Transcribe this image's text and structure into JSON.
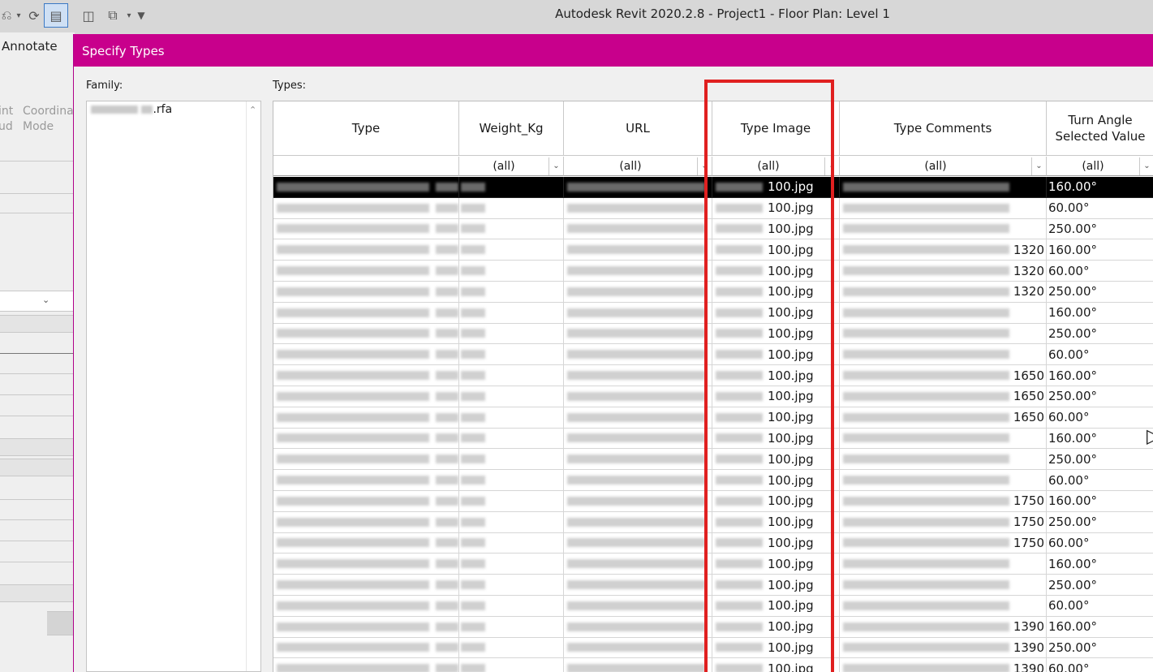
{
  "app": {
    "title": "Autodesk Revit 2020.2.8 - Project1 - Floor Plan: Level 1",
    "ribbon_tab": "Annotate",
    "ribbon_buttons": [
      {
        "line1": "int",
        "line2": "ud"
      },
      {
        "line1": "Coordina",
        "line2": "Mode"
      }
    ]
  },
  "dialog": {
    "title": "Specify Types",
    "family_label": "Family:",
    "family_item_suffix": ".rfa",
    "types_label": "Types:"
  },
  "columns": [
    {
      "id": "type",
      "header": "Type",
      "filter": ""
    },
    {
      "id": "weight",
      "header": "Weight_Kg",
      "filter": "(all)"
    },
    {
      "id": "url",
      "header": "URL",
      "filter": "(all)"
    },
    {
      "id": "type_image",
      "header": "Type Image",
      "filter": "(all)"
    },
    {
      "id": "type_comments",
      "header": "Type Comments",
      "filter": "(all)"
    },
    {
      "id": "turn_angle",
      "header": "Turn Angle Selected Value",
      "filter": "(all)"
    }
  ],
  "rows": [
    {
      "image": "100.jpg",
      "comment": "",
      "angle": "160.00°",
      "selected": true
    },
    {
      "image": "100.jpg",
      "comment": "",
      "angle": "60.00°"
    },
    {
      "image": "100.jpg",
      "comment": "",
      "angle": "250.00°"
    },
    {
      "image": "100.jpg",
      "comment": "1320",
      "angle": "160.00°"
    },
    {
      "image": "100.jpg",
      "comment": "1320",
      "angle": "60.00°"
    },
    {
      "image": "100.jpg",
      "comment": "1320",
      "angle": "250.00°"
    },
    {
      "image": "100.jpg",
      "comment": "",
      "angle": "160.00°"
    },
    {
      "image": "100.jpg",
      "comment": "",
      "angle": "250.00°"
    },
    {
      "image": "100.jpg",
      "comment": "",
      "angle": "60.00°"
    },
    {
      "image": "100.jpg",
      "comment": "1650",
      "angle": "160.00°"
    },
    {
      "image": "100.jpg",
      "comment": "1650",
      "angle": "250.00°"
    },
    {
      "image": "100.jpg",
      "comment": "1650",
      "angle": "60.00°"
    },
    {
      "image": "100.jpg",
      "comment": "",
      "angle": "160.00°"
    },
    {
      "image": "100.jpg",
      "comment": "",
      "angle": "250.00°"
    },
    {
      "image": "100.jpg",
      "comment": "",
      "angle": "60.00°"
    },
    {
      "image": "100.jpg",
      "comment": "1750",
      "angle": "160.00°"
    },
    {
      "image": "100.jpg",
      "comment": "1750",
      "angle": "250.00°"
    },
    {
      "image": "100.jpg",
      "comment": "1750",
      "angle": "60.00°"
    },
    {
      "image": "100.jpg",
      "comment": "",
      "angle": "160.00°"
    },
    {
      "image": "100.jpg",
      "comment": "",
      "angle": "250.00°"
    },
    {
      "image": "100.jpg",
      "comment": "",
      "angle": "60.00°"
    },
    {
      "image": "100.jpg",
      "comment": "1390",
      "angle": "160.00°"
    },
    {
      "image": "100.jpg",
      "comment": "1390",
      "angle": "250.00°"
    },
    {
      "image": "100.jpg",
      "comment": "1390",
      "angle": "60.00°"
    }
  ],
  "colors": {
    "dialog_title_bar": "#c8008c",
    "highlight_box": "#e02020",
    "selected_row": "#000000"
  },
  "icons": [
    "chevron-down-icon",
    "redo-icon",
    "properties-icon",
    "window-icon",
    "switch-windows-icon",
    "customize-icon",
    "scroll-up-icon",
    "cursor-icon"
  ]
}
